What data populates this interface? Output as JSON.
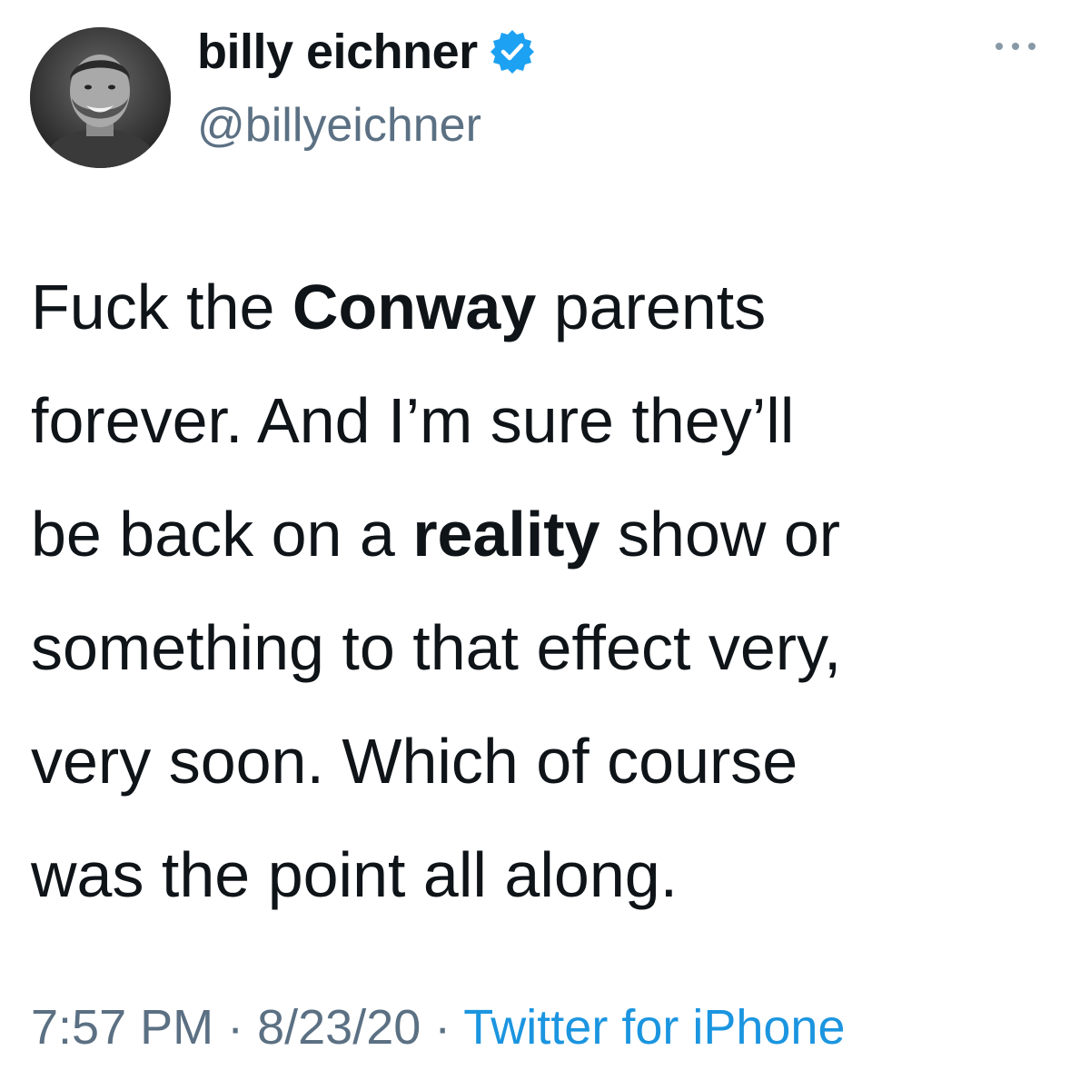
{
  "author": {
    "display_name": "billy eichner",
    "handle": "@billyeichner",
    "verified": true,
    "avatar_icon": "profile-photo"
  },
  "more_icon": "more-dots-icon",
  "tweet": {
    "lines": [
      {
        "a": "Fuck the ",
        "b": "Conway",
        "c": " parents"
      },
      {
        "a": "forever. And I’m sure they’ll",
        "b": "",
        "c": ""
      },
      {
        "a": "be back on a ",
        "b": "reality",
        "c": " show or"
      },
      {
        "a": "something to that effect very,",
        "b": "",
        "c": ""
      },
      {
        "a": "very soon. Which of course",
        "b": "",
        "c": ""
      },
      {
        "a": "was the point all along.",
        "b": "",
        "c": ""
      }
    ]
  },
  "meta": {
    "time": "7:57 PM",
    "sep1": " · ",
    "date": "8/23/20",
    "sep2": " · ",
    "source": "Twitter for iPhone"
  },
  "colors": {
    "text": "#0f1419",
    "secondary": "#5b7083",
    "link": "#1b95e0",
    "verified": "#1da1f2"
  }
}
